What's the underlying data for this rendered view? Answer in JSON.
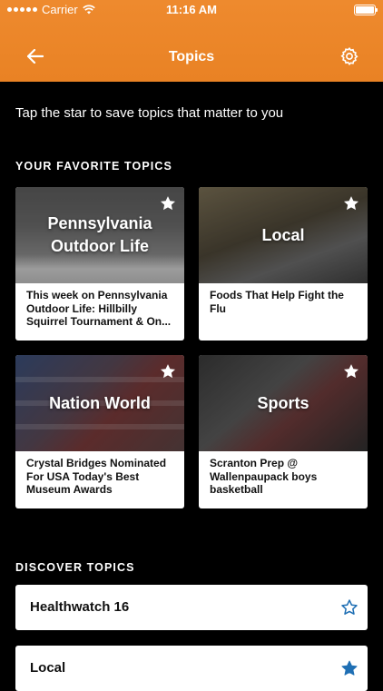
{
  "status_bar": {
    "carrier": "Carrier",
    "time": "11:16 AM",
    "battery_level_percent": 100
  },
  "nav": {
    "title": "Topics",
    "back_icon": "arrow-left-icon",
    "settings_icon": "gear-icon"
  },
  "intro_text": "Tap the star to save topics that matter to you",
  "favorites": {
    "title": "YOUR FAVORITE TOPICS",
    "cards": [
      {
        "image_label": "Pennsylvania\nOutdoor Life",
        "headline": "This week on Pennsylvania Outdoor Life:  Hillbilly Squirrel Tournament & On...",
        "starred": true
      },
      {
        "image_label": "Local",
        "headline": "Foods That Help Fight the Flu",
        "starred": true
      },
      {
        "image_label": "Nation World",
        "headline": "Crystal Bridges Nominated For USA Today's Best Museum Awards",
        "starred": true
      },
      {
        "image_label": "Sports",
        "headline": "Scranton Prep @ Wallenpaupack boys basketball",
        "starred": true
      }
    ]
  },
  "discover": {
    "title": "DISCOVER TOPICS",
    "items": [
      {
        "label": "Healthwatch 16",
        "starred": false
      },
      {
        "label": "Local",
        "starred": true
      }
    ]
  },
  "colors": {
    "header": "#e98224",
    "background": "#000000",
    "star_blue": "#1f6fb4",
    "star_white": "#ffffff"
  }
}
